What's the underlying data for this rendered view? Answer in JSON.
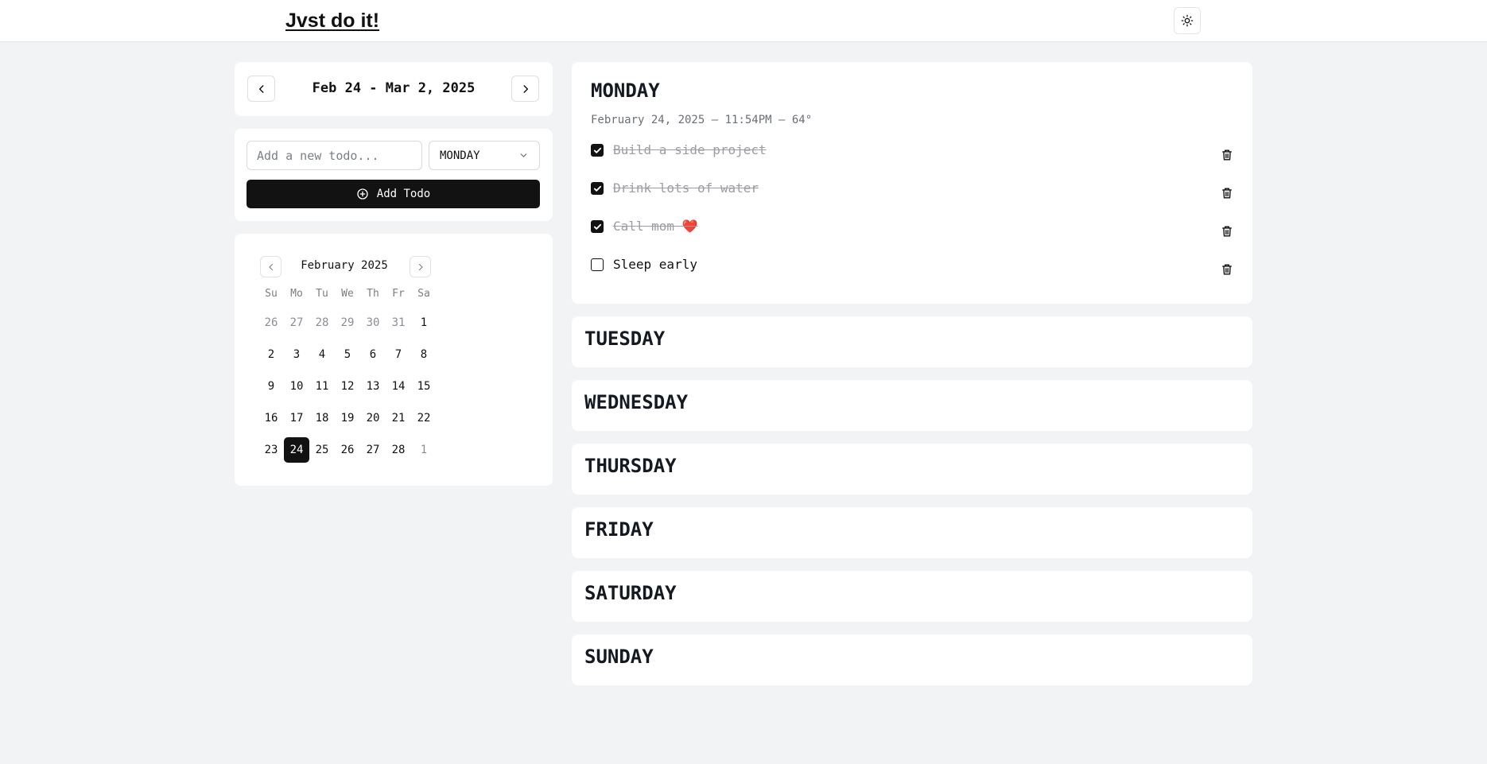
{
  "header": {
    "brand": "Jvst do it!",
    "theme_icon": "sun-icon"
  },
  "week_nav": {
    "label": "Feb 24 - Mar 2, 2025",
    "prev_icon": "chevron-left-icon",
    "next_icon": "chevron-right-icon"
  },
  "add_todo": {
    "placeholder": "Add a new todo...",
    "day_selected": "MONDAY",
    "button_label": "Add Todo",
    "button_icon": "plus-circle-icon"
  },
  "calendar": {
    "month_label": "February 2025",
    "weekdays": [
      "Su",
      "Mo",
      "Tu",
      "We",
      "Th",
      "Fr",
      "Sa"
    ],
    "weeks": [
      [
        "26",
        "27",
        "28",
        "29",
        "30",
        "31",
        "1"
      ],
      [
        "2",
        "3",
        "4",
        "5",
        "6",
        "7",
        "8"
      ],
      [
        "9",
        "10",
        "11",
        "12",
        "13",
        "14",
        "15"
      ],
      [
        "16",
        "17",
        "18",
        "19",
        "20",
        "21",
        "22"
      ],
      [
        "23",
        "24",
        "25",
        "26",
        "27",
        "28",
        "1"
      ]
    ],
    "selected_day": "24"
  },
  "days": {
    "monday": {
      "title": "MONDAY",
      "meta": "February 24, 2025 — 11:54PM — 64°",
      "todos": [
        {
          "text": "Build a side project",
          "done": true
        },
        {
          "text": "Drink lots of water",
          "done": true
        },
        {
          "text": "Call mom ❤️",
          "done": true
        },
        {
          "text": "Sleep early",
          "done": false
        }
      ]
    },
    "tuesday": {
      "title": "TUESDAY"
    },
    "wednesday": {
      "title": "WEDNESDAY"
    },
    "thursday": {
      "title": "THURSDAY"
    },
    "friday": {
      "title": "FRIDAY"
    },
    "saturday": {
      "title": "SATURDAY"
    },
    "sunday": {
      "title": "SUNDAY"
    }
  },
  "colors": {
    "background": "#f2f3f5",
    "accent": "#121212",
    "done_text": "#9a9da3"
  }
}
